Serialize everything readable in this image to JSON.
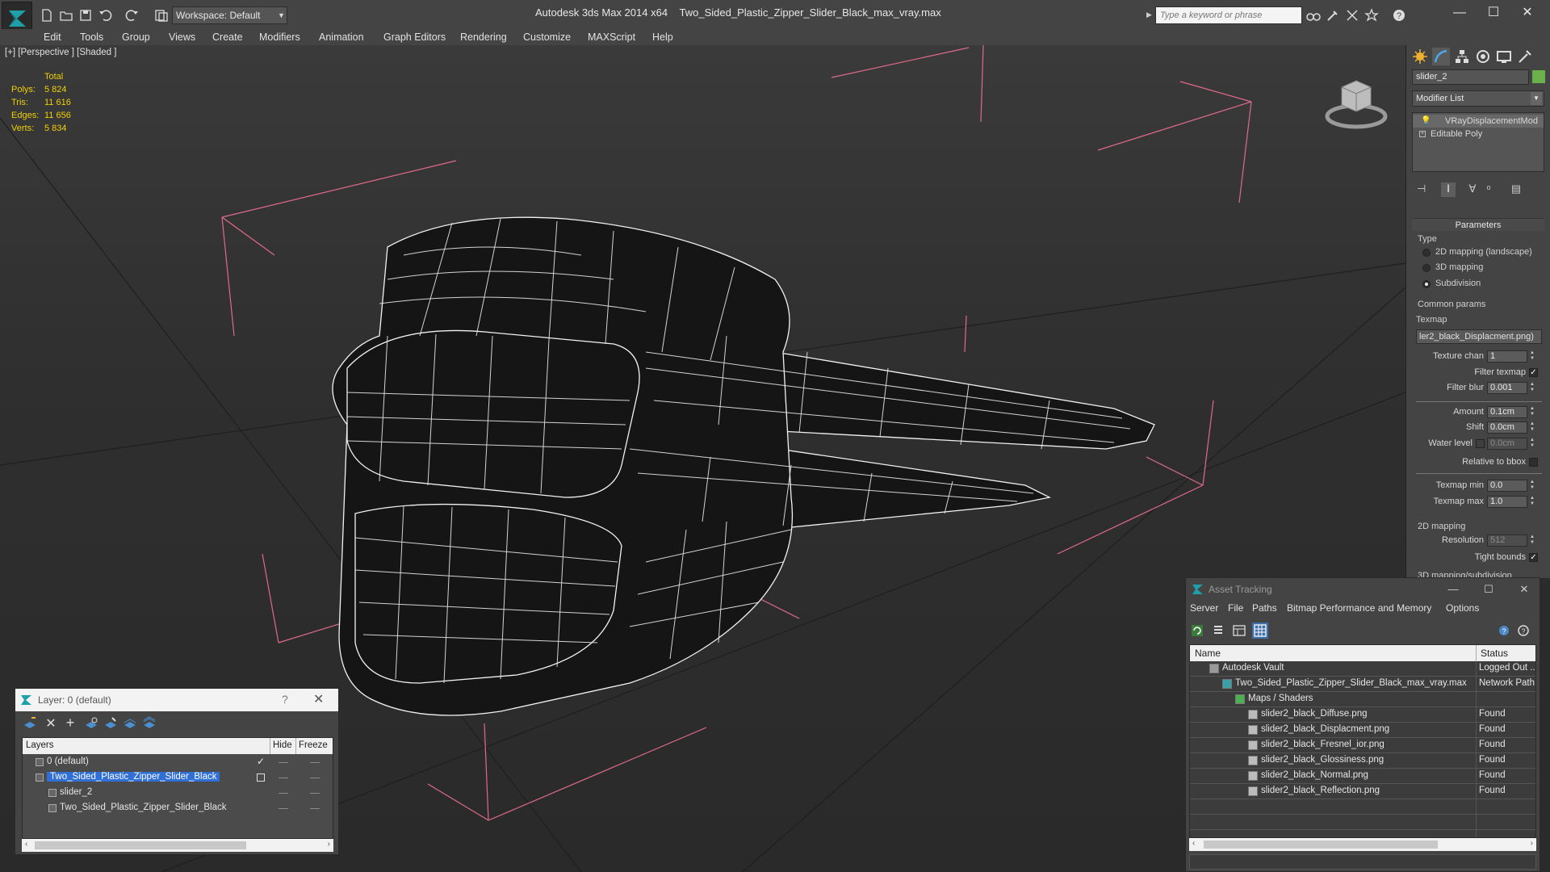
{
  "titlebar": {
    "workspace": "Workspace: Default",
    "app_name": "Autodesk 3ds Max  2014 x64",
    "file_name": "Two_Sided_Plastic_Zipper_Slider_Black_max_vray.max",
    "search_placeholder": "Type a keyword or phrase"
  },
  "menu": [
    "Edit",
    "Tools",
    "Group",
    "Views",
    "Create",
    "Modifiers",
    "Animation",
    "Graph Editors",
    "Rendering",
    "Customize",
    "MAXScript",
    "Help"
  ],
  "viewport": {
    "label": "[+] [Perspective ] [Shaded ]",
    "stats": {
      "header": "Total",
      "rows": [
        {
          "k": "Polys:",
          "v": "5 824"
        },
        {
          "k": "Tris:",
          "v": "11 616"
        },
        {
          "k": "Edges:",
          "v": "11 656"
        },
        {
          "k": "Verts:",
          "v": "5 834"
        }
      ]
    }
  },
  "command_panel": {
    "object_name": "slider_2",
    "object_color": "#6ab04c",
    "modifier_list": "Modifier List",
    "stack": [
      "VRayDisplacementMod",
      "Editable Poly"
    ],
    "parameters_title": "Parameters",
    "type_label": "Type",
    "type_options": [
      {
        "label": "2D mapping (landscape)",
        "selected": false
      },
      {
        "label": "3D mapping",
        "selected": false
      },
      {
        "label": "Subdivision",
        "selected": true
      }
    ],
    "common_params": "Common params",
    "texmap_label": "Texmap",
    "texmap_value": "ler2_black_Displacment.png)",
    "texture_chan_label": "Texture chan",
    "texture_chan": "1",
    "filter_texmap_label": "Filter texmap",
    "filter_blur_label": "Filter blur",
    "filter_blur": "0.001",
    "amount_label": "Amount",
    "amount": "0.1cm",
    "shift_label": "Shift",
    "shift": "0.0cm",
    "water_level_label": "Water level",
    "water_level": "0.0cm",
    "relative_bbox_label": "Relative to bbox",
    "texmap_min_label": "Texmap min",
    "texmap_min": "0.0",
    "texmap_max_label": "Texmap max",
    "texmap_max": "1.0",
    "mapping_2d": "2D mapping",
    "resolution_label": "Resolution",
    "resolution": "512",
    "tight_bounds_label": "Tight bounds",
    "partial_label": "3D mapping/subdivision"
  },
  "asset_tracking": {
    "title": "Asset Tracking",
    "menu": [
      "Server",
      "File",
      "Paths",
      "Bitmap Performance and Memory",
      "Options"
    ],
    "col_name": "Name",
    "col_status": "Status",
    "rows": [
      {
        "name": "Autodesk Vault",
        "status": "Logged Out ..",
        "indent": 1,
        "icon": "vault-icon"
      },
      {
        "name": "Two_Sided_Plastic_Zipper_Slider_Black_max_vray.max",
        "status": "Network Path",
        "indent": 2,
        "icon": "max-file-icon"
      },
      {
        "name": "Maps / Shaders",
        "status": "",
        "indent": 3,
        "icon": "maps-icon"
      },
      {
        "name": "slider2_black_Diffuse.png",
        "status": "Found",
        "indent": 4,
        "icon": "image-file-icon"
      },
      {
        "name": "slider2_black_Displacment.png",
        "status": "Found",
        "indent": 4,
        "icon": "image-file-icon"
      },
      {
        "name": "slider2_black_Fresnel_ior.png",
        "status": "Found",
        "indent": 4,
        "icon": "image-file-icon"
      },
      {
        "name": "slider2_black_Glossiness.png",
        "status": "Found",
        "indent": 4,
        "icon": "image-file-icon"
      },
      {
        "name": "slider2_black_Normal.png",
        "status": "Found",
        "indent": 4,
        "icon": "image-file-icon"
      },
      {
        "name": "slider2_black_Reflection.png",
        "status": "Found",
        "indent": 4,
        "icon": "image-file-icon"
      }
    ]
  },
  "layers": {
    "title": "Layer: 0 (default)",
    "help": "?",
    "col_layers": "Layers",
    "col_hide": "Hide",
    "col_freeze": "Freeze",
    "rows": [
      {
        "name": "0 (default)",
        "indent": 1,
        "selected": false,
        "active": true
      },
      {
        "name": "Two_Sided_Plastic_Zipper_Slider_Black",
        "indent": 1,
        "selected": true,
        "active": false
      },
      {
        "name": "slider_2",
        "indent": 2,
        "selected": false,
        "active": false
      },
      {
        "name": "Two_Sided_Plastic_Zipper_Slider_Black",
        "indent": 2,
        "selected": false,
        "active": false
      }
    ]
  }
}
